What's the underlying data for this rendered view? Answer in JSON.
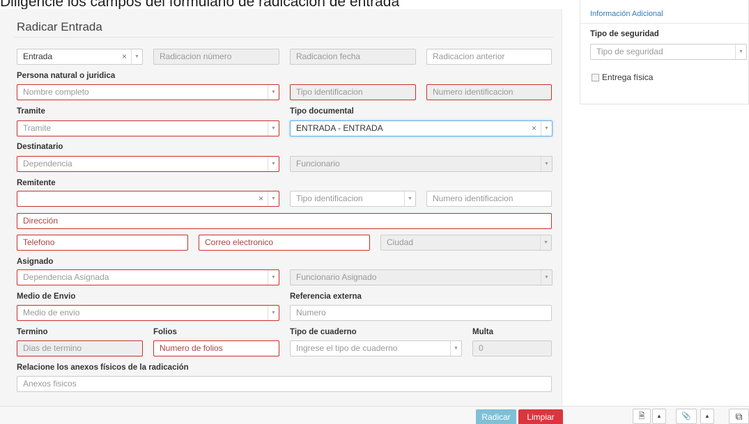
{
  "caption": "Diligencie los campos del formulario de radicación de entrada",
  "form": {
    "title": "Radicar Entrada",
    "tipo_radicacion": {
      "value": "Entrada"
    },
    "radicacion_numero": {
      "placeholder": "Radicacion número"
    },
    "radicacion_fecha": {
      "placeholder": "Radicacion fecha"
    },
    "radicacion_anterior": {
      "placeholder": "Radicacion anterior"
    },
    "persona": {
      "label": "Persona natural o juridica",
      "placeholder": "Nombre completo"
    },
    "persona_tipo_id": {
      "placeholder": "Tipo identificacion"
    },
    "persona_num_id": {
      "placeholder": "Numero identificacion"
    },
    "tramite": {
      "label": "Tramite",
      "placeholder": "Tramite"
    },
    "tipo_documental": {
      "label": "Tipo documental",
      "value": "ENTRADA - ENTRADA"
    },
    "destinatario": {
      "label": "Destinatario",
      "dependencia": "Dependencia",
      "funcionario": "Funcionario"
    },
    "remitente": {
      "label": "Remitente",
      "value": "",
      "tipo_id": "Tipo identificacion",
      "num_id": "Numero identificacion",
      "direccion": "Dirección",
      "telefono": "Telefono",
      "correo": "Correo electronico",
      "ciudad": "Ciudad"
    },
    "asignado": {
      "label": "Asignado",
      "dependencia": "Dependencia Asignada",
      "funcionario": "Funcionario Asignado"
    },
    "medio_envio": {
      "label": "Medio de Envio",
      "placeholder": "Medio de envio"
    },
    "referencia_externa": {
      "label": "Referencia externa",
      "placeholder": "Numero"
    },
    "termino": {
      "label": "Termino",
      "placeholder": "Dias de termino"
    },
    "folios": {
      "label": "Folios",
      "placeholder": "Numero de folios"
    },
    "tipo_cuaderno": {
      "label": "Tipo de cuaderno",
      "placeholder": "Ingrese el tipo de cuaderno"
    },
    "multa": {
      "label": "Multa",
      "value": "0"
    },
    "anexos": {
      "label": "Relacione los anexos físicos de la radicación",
      "placeholder": "Anexos fisicos"
    }
  },
  "sidebar": {
    "heading": "Información Adicional",
    "seguridad": {
      "label": "Tipo de seguridad",
      "placeholder": "Tipo de seguridad"
    },
    "entrega_fisica": {
      "label": "Entrega física",
      "checked": false
    }
  },
  "footer": {
    "radicar_label": "Radicar",
    "limpiar_label": "Limpiar",
    "icons": [
      "document-icon",
      "caret-up-icon",
      "paperclip-icon",
      "caret-up-icon",
      "copy-icon"
    ]
  },
  "colors": {
    "error_border": "#c9302c",
    "link_blue": "#337ab7",
    "primary_button": "#7ec0d6",
    "danger_button": "#d9363e"
  },
  "glyphs": {
    "clear": "×",
    "caret_down": "▼",
    "caret_up": "▲",
    "doc": "🗎",
    "clip": "📎",
    "copy": "⧉"
  }
}
